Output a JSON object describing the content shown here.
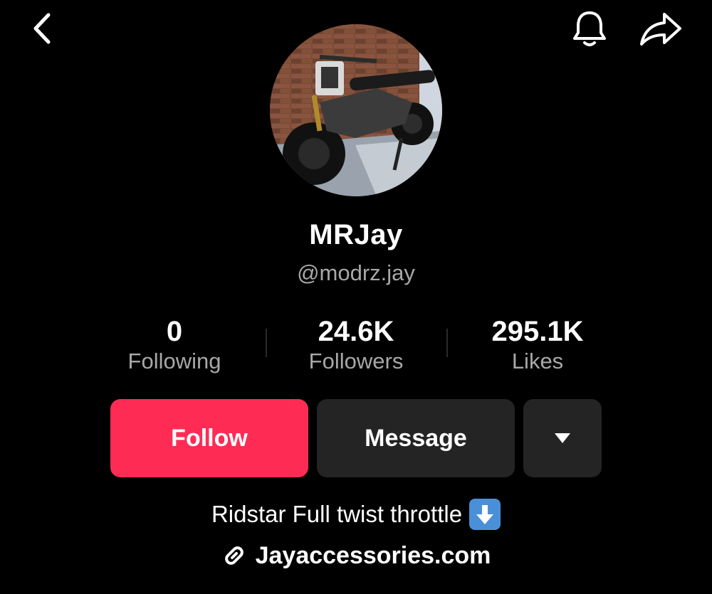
{
  "profile": {
    "name": "MRJay",
    "handle": "@modrz.jay",
    "bio": "Ridstar Full twist throttle",
    "link": "Jayaccessories.com"
  },
  "stats": [
    {
      "value": "0",
      "label": "Following"
    },
    {
      "value": "24.6K",
      "label": "Followers"
    },
    {
      "value": "295.1K",
      "label": "Likes"
    }
  ],
  "actions": {
    "follow_label": "Follow",
    "message_label": "Message"
  },
  "icons": {
    "back": "chevron-left-icon",
    "bell": "bell-icon",
    "share": "share-arrow-icon",
    "more": "caret-down-icon",
    "bio_emoji": "down-arrow-emoji-icon",
    "link": "link-icon"
  },
  "colors": {
    "background": "#000000",
    "follow_button": "#fe2c55",
    "secondary_button": "#242424",
    "muted_text": "#a8a8a8"
  }
}
